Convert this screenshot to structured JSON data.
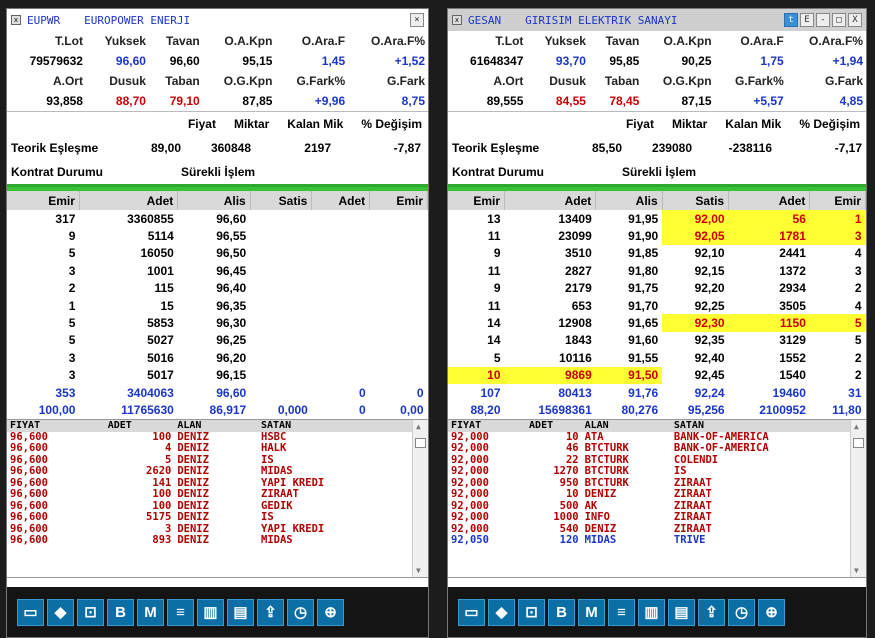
{
  "panels": [
    {
      "code": "EUPWR",
      "name": "EUROPOWER ENERJI",
      "title_buttons": [],
      "hdr1": [
        "T.Lot",
        "Yuksek",
        "Tavan",
        "O.A.Kpn",
        "O.Ara.F",
        "O.Ara.F%"
      ],
      "val1": [
        "79579632",
        "96,60",
        "96,60",
        "95,15",
        "1,45",
        "+1,52"
      ],
      "hdr2": [
        "A.Ort",
        "Dusuk",
        "Taban",
        "O.G.Kpn",
        "G.Fark%",
        "G.Fark"
      ],
      "val2": [
        "93,858",
        "88,70",
        "79,10",
        "87,85",
        "+9,96",
        "8,75"
      ],
      "teorik_hdr": [
        "Fiyat",
        "Miktar",
        "Kalan Mik",
        "% Değişim"
      ],
      "teorik_label": "Teorik Eşleşme",
      "teorik_vals": [
        "89,00",
        "360848",
        "2197",
        "-7,87"
      ],
      "kontrat_label": "Kontrat Durumu",
      "kontrat_val": "Sürekli İşlem",
      "book_hdr": [
        "Emir",
        "Adet",
        "Alis",
        "Satis",
        "Adet",
        "Emir"
      ],
      "book": [
        [
          "317",
          "3360855",
          "96,60",
          "",
          "",
          ""
        ],
        [
          "9",
          "5114",
          "96,55",
          "",
          "",
          ""
        ],
        [
          "5",
          "16050",
          "96,50",
          "",
          "",
          ""
        ],
        [
          "3",
          "1001",
          "96,45",
          "",
          "",
          ""
        ],
        [
          "2",
          "115",
          "96,40",
          "",
          "",
          ""
        ],
        [
          "1",
          "15",
          "96,35",
          "",
          "",
          ""
        ],
        [
          "5",
          "5853",
          "96,30",
          "",
          "",
          ""
        ],
        [
          "5",
          "5027",
          "96,25",
          "",
          "",
          ""
        ],
        [
          "3",
          "5016",
          "96,20",
          "",
          "",
          ""
        ],
        [
          "3",
          "5017",
          "96,15",
          "",
          "",
          ""
        ]
      ],
      "sum": [
        "353",
        "3404063",
        "96,60",
        "",
        "0",
        "0"
      ],
      "last": [
        "100,00",
        "11765630",
        "86,917",
        "0,000",
        "0",
        "0,00"
      ],
      "trade_hdr": [
        "FIYAT",
        "ADET",
        "ALAN",
        "SATAN"
      ],
      "trades": [
        [
          "96,600",
          "100",
          "DENIZ",
          "HSBC"
        ],
        [
          "96,600",
          "4",
          "DENIZ",
          "HALK"
        ],
        [
          "96,600",
          "5",
          "DENIZ",
          "IS"
        ],
        [
          "96,600",
          "2620",
          "DENIZ",
          "MIDAS"
        ],
        [
          "96,600",
          "141",
          "DENIZ",
          "YAPI KREDI"
        ],
        [
          "96,600",
          "100",
          "DENIZ",
          "ZIRAAT"
        ],
        [
          "96,600",
          "100",
          "DENIZ",
          "GEDIK"
        ],
        [
          "96,600",
          "5175",
          "DENIZ",
          "IS"
        ],
        [
          "96,600",
          "3",
          "DENIZ",
          "YAPI KREDI"
        ],
        [
          "96,600",
          "893",
          "DENIZ",
          "MIDAS"
        ]
      ]
    },
    {
      "code": "GESAN",
      "name": "GIRISIM ELEKTRIK SANAYI",
      "title_buttons": [
        "E",
        "-",
        "□",
        "X"
      ],
      "hdr1": [
        "T.Lot",
        "Yuksek",
        "Tavan",
        "O.A.Kpn",
        "O.Ara.F",
        "O.Ara.F%"
      ],
      "val1": [
        "61648347",
        "93,70",
        "95,85",
        "90,25",
        "1,75",
        "+1,94"
      ],
      "hdr2": [
        "A.Ort",
        "Dusuk",
        "Taban",
        "O.G.Kpn",
        "G.Fark%",
        "G.Fark"
      ],
      "val2": [
        "89,555",
        "84,55",
        "78,45",
        "87,15",
        "+5,57",
        "4,85"
      ],
      "teorik_hdr": [
        "Fiyat",
        "Miktar",
        "Kalan Mik",
        "% Değişim"
      ],
      "teorik_label": "Teorik Eşleşme",
      "teorik_vals": [
        "85,50",
        "239080",
        "-238116",
        "-7,17"
      ],
      "kontrat_label": "Kontrat Durumu",
      "kontrat_val": "Sürekli İşlem",
      "book_hdr": [
        "Emir",
        "Adet",
        "Alis",
        "Satis",
        "Adet",
        "Emir"
      ],
      "book": [
        [
          "13",
          "13409",
          "91,95",
          "92,00",
          "56",
          "1"
        ],
        [
          "11",
          "23099",
          "91,90",
          "92,05",
          "1781",
          "3"
        ],
        [
          "9",
          "3510",
          "91,85",
          "92,10",
          "2441",
          "4"
        ],
        [
          "11",
          "2827",
          "91,80",
          "92,15",
          "1372",
          "3"
        ],
        [
          "9",
          "2179",
          "91,75",
          "92,20",
          "2934",
          "2"
        ],
        [
          "11",
          "653",
          "91,70",
          "92,25",
          "3505",
          "4"
        ],
        [
          "14",
          "12908",
          "91,65",
          "92,30",
          "1150",
          "5"
        ],
        [
          "14",
          "1843",
          "91,60",
          "92,35",
          "3129",
          "5"
        ],
        [
          "5",
          "10116",
          "91,55",
          "92,40",
          "1552",
          "2"
        ],
        [
          "10",
          "9869",
          "91,50",
          "92,45",
          "1540",
          "2"
        ]
      ],
      "sum": [
        "107",
        "80413",
        "91,76",
        "92,24",
        "19460",
        "31"
      ],
      "last": [
        "88,20",
        "15698361",
        "80,276",
        "95,256",
        "2100952",
        "11,80"
      ],
      "trade_hdr": [
        "FIYAT",
        "ADET",
        "ALAN",
        "SATAN"
      ],
      "trades": [
        [
          "92,000",
          "10",
          "ATA",
          "BANK-OF-AMERICA"
        ],
        [
          "92,000",
          "46",
          "BTCTURK",
          "BANK-OF-AMERICA"
        ],
        [
          "92,000",
          "22",
          "BTCTURK",
          "COLENDI"
        ],
        [
          "92,000",
          "1270",
          "BTCTURK",
          "IS"
        ],
        [
          "92,000",
          "950",
          "BTCTURK",
          "ZIRAAT"
        ],
        [
          "92,000",
          "10",
          "DENIZ",
          "ZIRAAT"
        ],
        [
          "92,000",
          "500",
          "AK",
          "ZIRAAT"
        ],
        [
          "92,000",
          "1000",
          "INFO",
          "ZIRAAT"
        ],
        [
          "92,000",
          "540",
          "DENIZ",
          "ZIRAAT"
        ],
        [
          "92,050",
          "120",
          "MIDAS",
          "TRIVE"
        ]
      ]
    }
  ],
  "toolbar_icons": [
    "monitor-icon",
    "cube-icon",
    "chart-doc-icon",
    "B",
    "M",
    "list-icon",
    "bar-chart-icon",
    "news-icon",
    "upload-icon",
    "clock-icon",
    "globe-icon"
  ],
  "toolbar_text": {
    "B": "B",
    "M": "M"
  },
  "colors": {
    "highlight": "#ffff33",
    "buy_blue": "#1a35c8",
    "sell_red": "#c80000",
    "green_bar": "#36c436"
  }
}
